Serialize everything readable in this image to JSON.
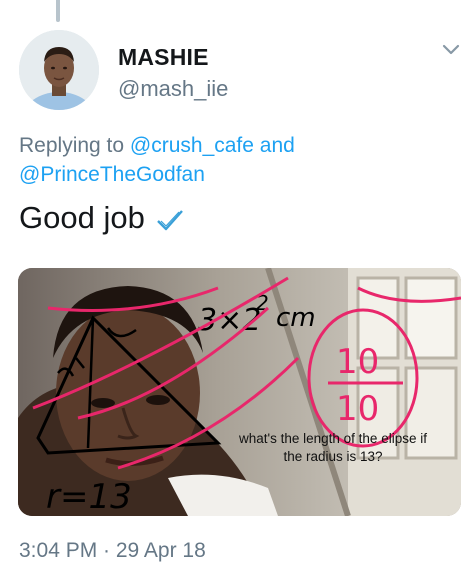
{
  "tweet": {
    "display_name": "MASHIE",
    "handle": "@mash_iie",
    "reply": {
      "prefix": "Replying to",
      "mention_1": "@crush_cafe",
      "conjunction": "and",
      "mention_2": "@PrinceTheGodfan"
    },
    "text": "Good job",
    "media": {
      "annotation_math": "3×2²cm",
      "fraction_top": "10",
      "fraction_bottom": "10",
      "left_label": "r=13",
      "side_label": "=13",
      "caption_line_1": "what's the length of the elipse if",
      "caption_line_2": "the radius is 13?"
    },
    "timestamp": "3:04 PM · 29 Apr 18"
  },
  "icons": {
    "chevron": "chevron-down-icon",
    "check": "check-icon",
    "avatar": "avatar"
  },
  "colors": {
    "link": "#1da1f2",
    "secondary_text": "#657786",
    "primary_text": "#14171a",
    "annotation_pink": "#e8276b"
  }
}
